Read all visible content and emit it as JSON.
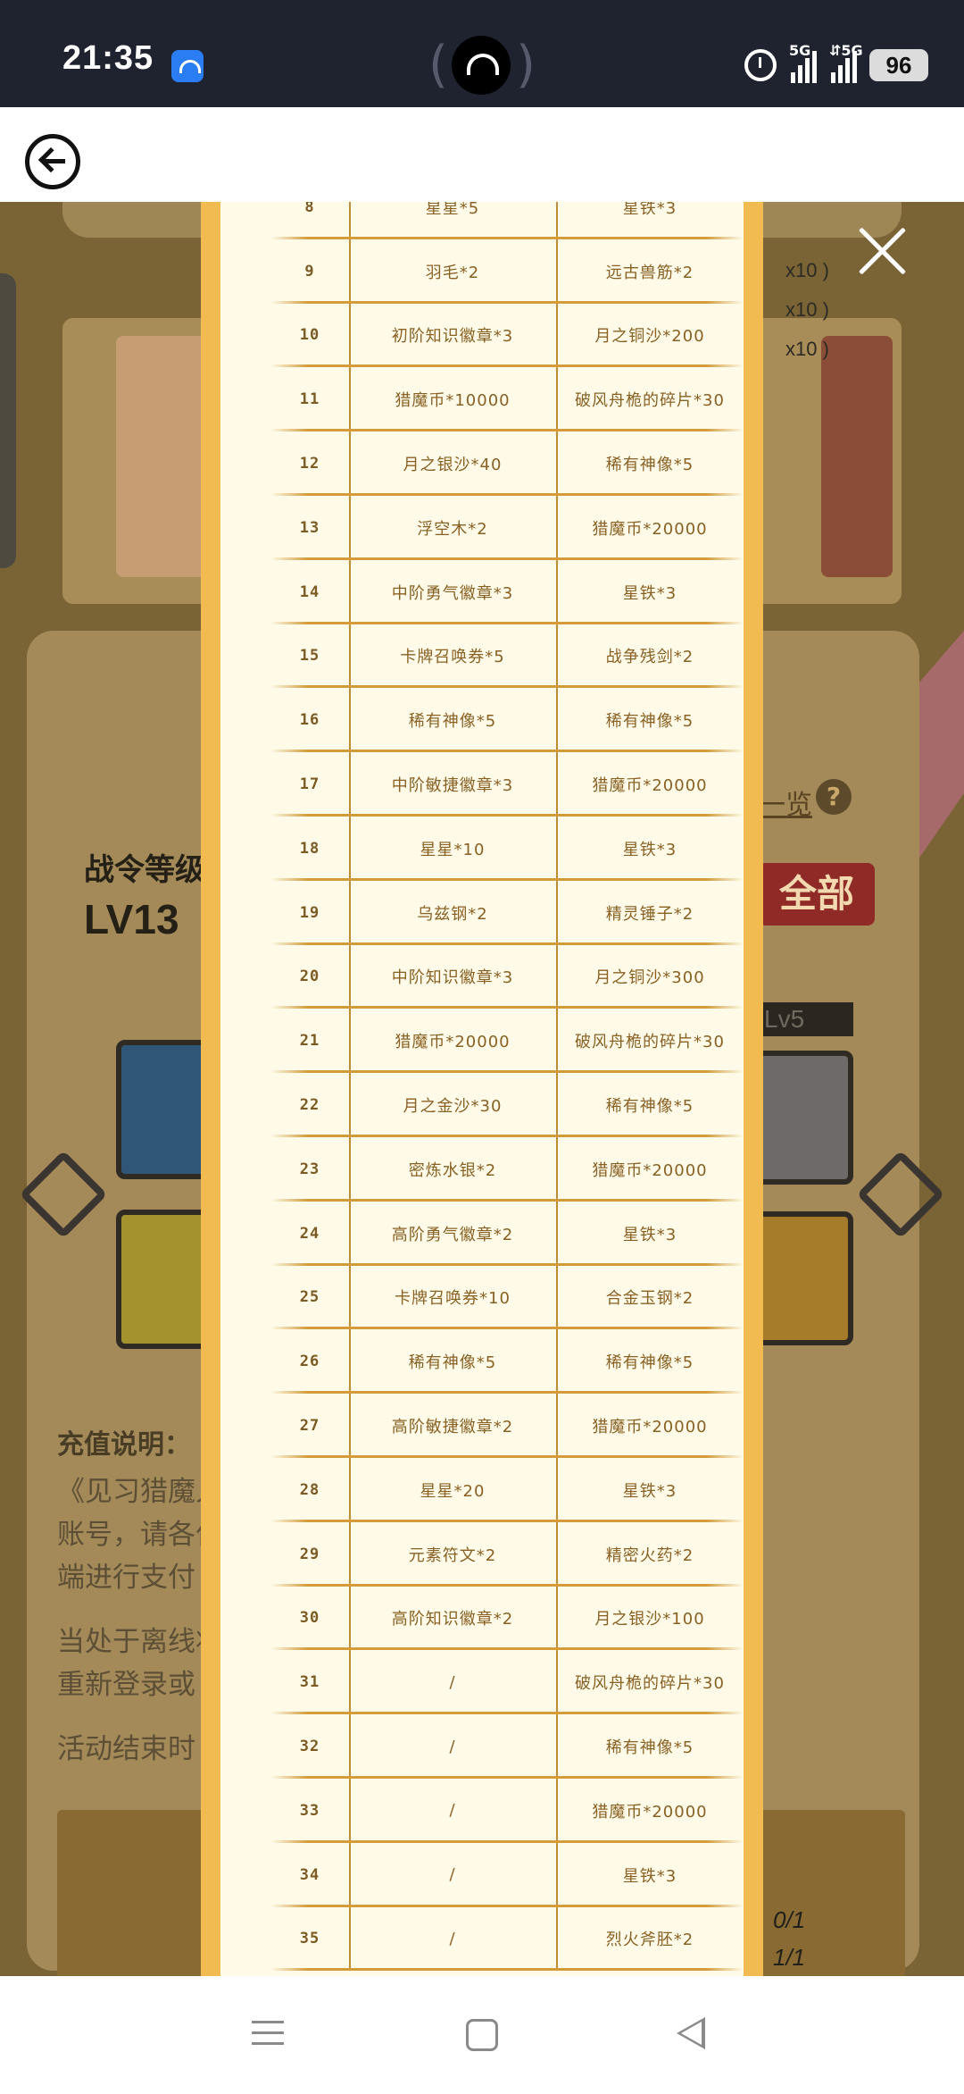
{
  "status_bar": {
    "time": "21:35",
    "network_1": "5G",
    "network_2": "⇵5G",
    "battery": "96"
  },
  "background": {
    "lv_title": "战令等级",
    "lv_value": "LV13",
    "overview_link": "一览",
    "help_glyph": "?",
    "claim_all": "全部",
    "lv_badge": "Lv5",
    "reward_lines": [
      "x10 )",
      "x10 )",
      "x10 )"
    ],
    "note_title": "充值说明：",
    "note_lines": [
      "《见习猎魔人》充值将发放到您的游戏",
      "账号，请各位猎魔人知悉，安卓以及PC",
      "端进行支付",
      "当处于离线状态时，若充值失败可尝试",
      "重新登录或",
      "活动结束时"
    ],
    "progress": [
      "0/1",
      "1/1"
    ]
  },
  "rewards": {
    "rows": [
      {
        "level": "8",
        "free": "星星*5",
        "paid": "星铁*3"
      },
      {
        "level": "9",
        "free": "羽毛*2",
        "paid": "远古兽筋*2"
      },
      {
        "level": "10",
        "free": "初阶知识徽章*3",
        "paid": "月之铜沙*200"
      },
      {
        "level": "11",
        "free": "猎魔币*10000",
        "paid": "破风舟桅的碎片*30"
      },
      {
        "level": "12",
        "free": "月之银沙*40",
        "paid": "稀有神像*5"
      },
      {
        "level": "13",
        "free": "浮空木*2",
        "paid": "猎魔币*20000"
      },
      {
        "level": "14",
        "free": "中阶勇气徽章*3",
        "paid": "星铁*3"
      },
      {
        "level": "15",
        "free": "卡牌召唤券*5",
        "paid": "战争残剑*2"
      },
      {
        "level": "16",
        "free": "稀有神像*5",
        "paid": "稀有神像*5"
      },
      {
        "level": "17",
        "free": "中阶敏捷徽章*3",
        "paid": "猎魔币*20000"
      },
      {
        "level": "18",
        "free": "星星*10",
        "paid": "星铁*3"
      },
      {
        "level": "19",
        "free": "乌兹钢*2",
        "paid": "精灵锤子*2"
      },
      {
        "level": "20",
        "free": "中阶知识徽章*3",
        "paid": "月之铜沙*300"
      },
      {
        "level": "21",
        "free": "猎魔币*20000",
        "paid": "破风舟桅的碎片*30"
      },
      {
        "level": "22",
        "free": "月之金沙*30",
        "paid": "稀有神像*5"
      },
      {
        "level": "23",
        "free": "密炼水银*2",
        "paid": "猎魔币*20000"
      },
      {
        "level": "24",
        "free": "高阶勇气徽章*2",
        "paid": "星铁*3"
      },
      {
        "level": "25",
        "free": "卡牌召唤券*10",
        "paid": "合金玉钢*2"
      },
      {
        "level": "26",
        "free": "稀有神像*5",
        "paid": "稀有神像*5"
      },
      {
        "level": "27",
        "free": "高阶敏捷徽章*2",
        "paid": "猎魔币*20000"
      },
      {
        "level": "28",
        "free": "星星*20",
        "paid": "星铁*3"
      },
      {
        "level": "29",
        "free": "元素符文*2",
        "paid": "精密火药*2"
      },
      {
        "level": "30",
        "free": "高阶知识徽章*2",
        "paid": "月之银沙*100"
      },
      {
        "level": "31",
        "free": "/",
        "paid": "破风舟桅的碎片*30"
      },
      {
        "level": "32",
        "free": "/",
        "paid": "稀有神像*5"
      },
      {
        "level": "33",
        "free": "/",
        "paid": "猎魔币*20000"
      },
      {
        "level": "34",
        "free": "/",
        "paid": "星铁*3"
      },
      {
        "level": "35",
        "free": "/",
        "paid": "烈火斧胚*2"
      }
    ]
  },
  "colors": {
    "scroll_frame": "#e0a43c",
    "paper": "#fffbe8",
    "row_text": "#8a6125",
    "divider": "#d39b3a"
  },
  "icons": {
    "back": "back-arrow-icon",
    "close": "close-icon",
    "alarm": "alarm-icon",
    "nav_menu": "menu-icon",
    "nav_home": "home-icon",
    "nav_back": "triangle-back-icon"
  }
}
